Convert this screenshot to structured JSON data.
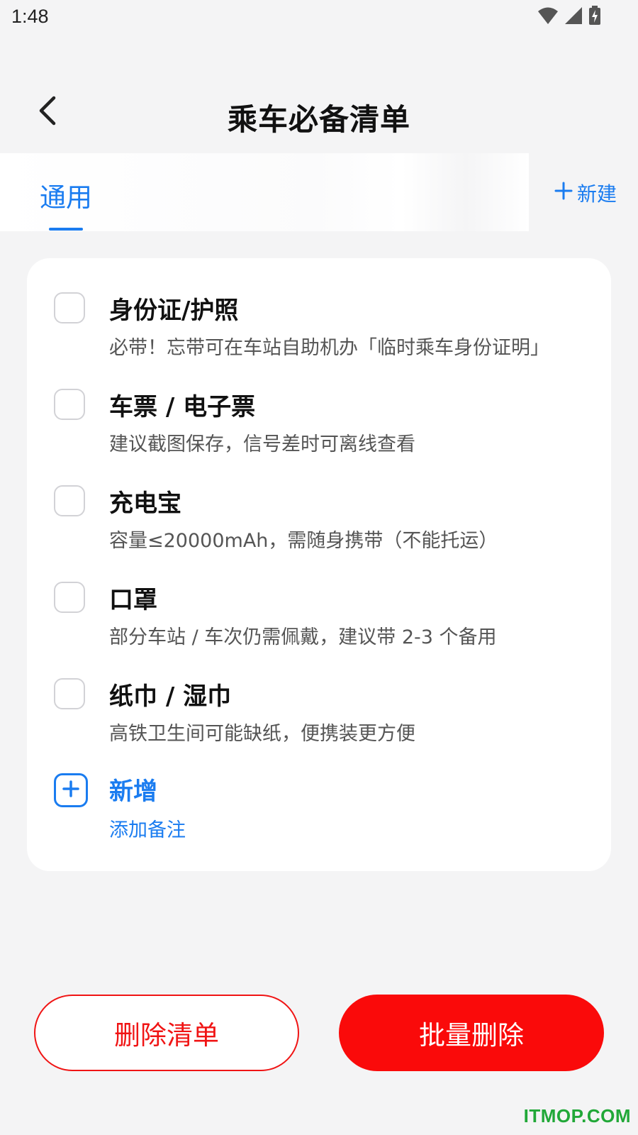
{
  "status_bar": {
    "time": "1:48",
    "icons": [
      "wifi-icon",
      "signal-icon",
      "battery-charging-icon"
    ]
  },
  "header": {
    "back_icon": "chevron-left-icon",
    "title": "乘车必备清单"
  },
  "tabs": {
    "items": [
      {
        "label": "通用",
        "active": true
      }
    ],
    "new_label": "新建",
    "new_icon": "plus-icon"
  },
  "checklist": {
    "items": [
      {
        "title": "身份证/护照",
        "note": "必带！忘带可在车站自助机办「临时乘车身份证明」",
        "checked": false
      },
      {
        "title": "车票 / 电子票",
        "note": "建议截图保存，信号差时可离线查看",
        "checked": false
      },
      {
        "title": "充电宝",
        "note": "容量≤20000mAh，需随身携带（不能托运）",
        "checked": false
      },
      {
        "title": "口罩",
        "note": "部分车站 / 车次仍需佩戴，建议带 2-3 个备用",
        "checked": false
      },
      {
        "title": "纸巾 / 湿巾",
        "note": "高铁卫生间可能缺纸，便携装更方便",
        "checked": false
      }
    ],
    "add": {
      "title": "新增",
      "note": "添加备注",
      "icon": "plus-square-icon"
    }
  },
  "actions": {
    "delete_list": "删除清单",
    "batch_delete": "批量删除"
  },
  "watermark": "ITMOP.COM",
  "colors": {
    "accent": "#1a7cf0",
    "danger": "#fa0a0a",
    "background": "#f4f4f5",
    "watermark": "#21a838"
  }
}
